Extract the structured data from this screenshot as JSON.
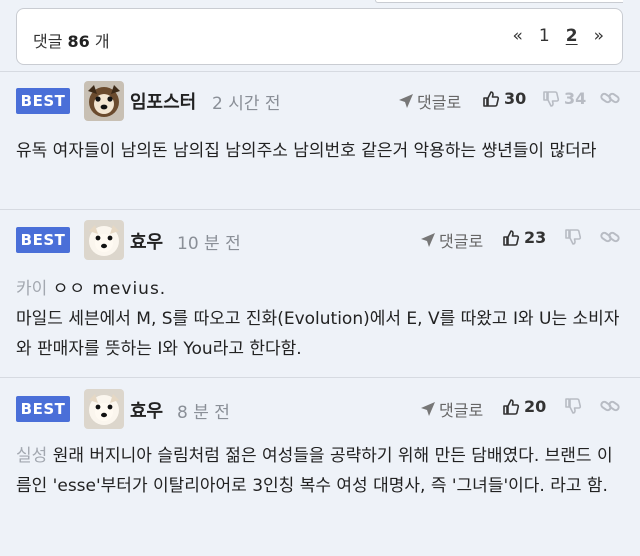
{
  "header": {
    "count_prefix": "댓글",
    "count": "86",
    "count_suffix": "개",
    "pager": {
      "first": "«",
      "page1": "1",
      "page2": "2",
      "next": "»"
    }
  },
  "comments": [
    {
      "badge": "BEST",
      "author": "임포스터",
      "time": "2 시간 전",
      "reply_label": "댓글로",
      "likes": "30",
      "dislikes": "34",
      "tag": "",
      "tag_extra": "",
      "text": "유독 여자들이 남의돈 남의집 남의주소 남의번호 같은거 악용하는 썅년들이 많더라"
    },
    {
      "badge": "BEST",
      "author": "효우",
      "time": "10 분 전",
      "reply_label": "댓글로",
      "likes": "23",
      "dislikes": "",
      "tag": "카이",
      "tag_extra": "ㅇㅇ mevius.",
      "text": "마일드 세븐에서 M, S를 따오고 진화(Evolution)에서 E, V를 따왔고 I와 U는 소비자와 판매자를 뜻하는 I와 You라고 한다함."
    },
    {
      "badge": "BEST",
      "author": "효우",
      "time": "8 분 전",
      "reply_label": "댓글로",
      "likes": "20",
      "dislikes": "",
      "tag": "실성",
      "tag_extra": "",
      "text": "원래 버지니아 슬림처럼 젊은 여성들을 공략하기 위해 만든 담배였다. 브랜드 이름인 'esse'부터가 이탈리아어로 3인칭 복수 여성 대명사, 즉 '그녀들'이다. 라고 함."
    }
  ],
  "colors": {
    "best_badge": "#4a6fd8",
    "page_bg": "#eef2f8",
    "muted": "#8a8f97"
  },
  "icons": [
    "reply-arrow-icon",
    "thumbs-up-icon",
    "thumbs-down-icon",
    "link-icon",
    "dog-avatar-icon"
  ]
}
